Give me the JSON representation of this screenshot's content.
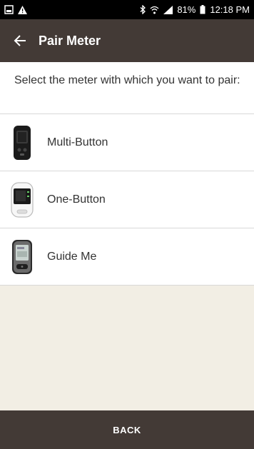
{
  "status_bar": {
    "battery": "81%",
    "time": "12:18 PM",
    "icons": [
      "notification-icon",
      "alert-icon",
      "bluetooth-icon",
      "wifi-icon",
      "signal-icon",
      "battery-icon"
    ]
  },
  "app_bar": {
    "back_icon": "arrow-left-icon",
    "title": "Pair Meter"
  },
  "prompt": "Select the meter with which you want to pair:",
  "meters": [
    {
      "label": "Multi-Button",
      "icon": "multi-button-meter-icon"
    },
    {
      "label": "One-Button",
      "icon": "one-button-meter-icon"
    },
    {
      "label": "Guide Me",
      "icon": "guide-me-meter-icon"
    }
  ],
  "footer": {
    "back_label": "BACK"
  },
  "colors": {
    "app_bar": "#433a36",
    "background": "#f2eee4",
    "status_bar": "#000000"
  }
}
